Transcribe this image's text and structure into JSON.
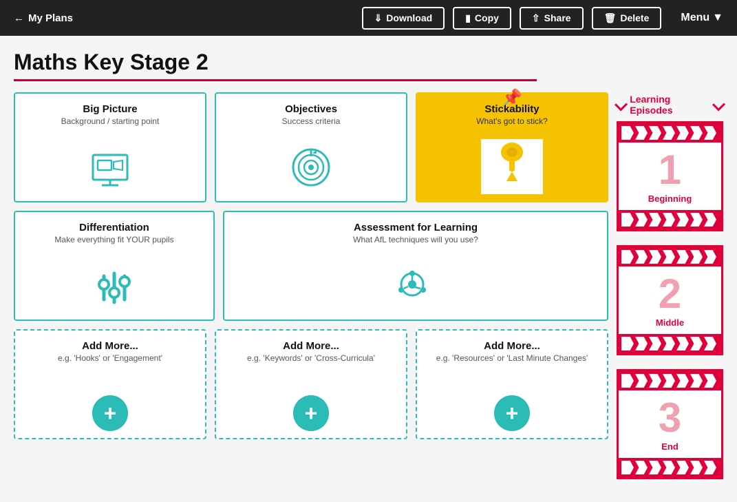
{
  "header": {
    "back_label": "My Plans",
    "download_label": "Download",
    "copy_label": "Copy",
    "share_label": "Share",
    "delete_label": "Delete",
    "menu_label": "Menu"
  },
  "page": {
    "title": "Maths Key Stage 2"
  },
  "episodes_header": "Learning Episodes",
  "cards": {
    "row1": [
      {
        "id": "big-picture",
        "title": "Big Picture",
        "subtitle": "Background / starting point",
        "icon_type": "presentation"
      },
      {
        "id": "objectives",
        "title": "Objectives",
        "subtitle": "Success criteria",
        "icon_type": "target"
      },
      {
        "id": "stickability",
        "title": "Stickability",
        "subtitle": "What's got to stick?",
        "icon_type": "pushpin",
        "special": "yellow"
      }
    ],
    "row2": [
      {
        "id": "differentiation",
        "title": "Differentiation",
        "subtitle": "Make everything fit YOUR pupils",
        "icon_type": "sliders"
      },
      {
        "id": "assessment",
        "title": "Assessment for Learning",
        "subtitle": "What AfL techniques will you use?",
        "icon_type": "afl"
      }
    ],
    "row3": [
      {
        "id": "add1",
        "title": "Add More...",
        "subtitle": "e.g. 'Hooks' or 'Engagement'",
        "icon_type": "add"
      },
      {
        "id": "add2",
        "title": "Add More...",
        "subtitle": "e.g. 'Keywords' or 'Cross-Curricula'",
        "icon_type": "add"
      },
      {
        "id": "add3",
        "title": "Add More...",
        "subtitle": "e.g. 'Resources' or 'Last Minute Changes'",
        "icon_type": "add"
      }
    ]
  },
  "episodes": [
    {
      "number": "1",
      "label": "Beginning"
    },
    {
      "number": "2",
      "label": "Middle"
    },
    {
      "number": "3",
      "label": "End"
    }
  ]
}
